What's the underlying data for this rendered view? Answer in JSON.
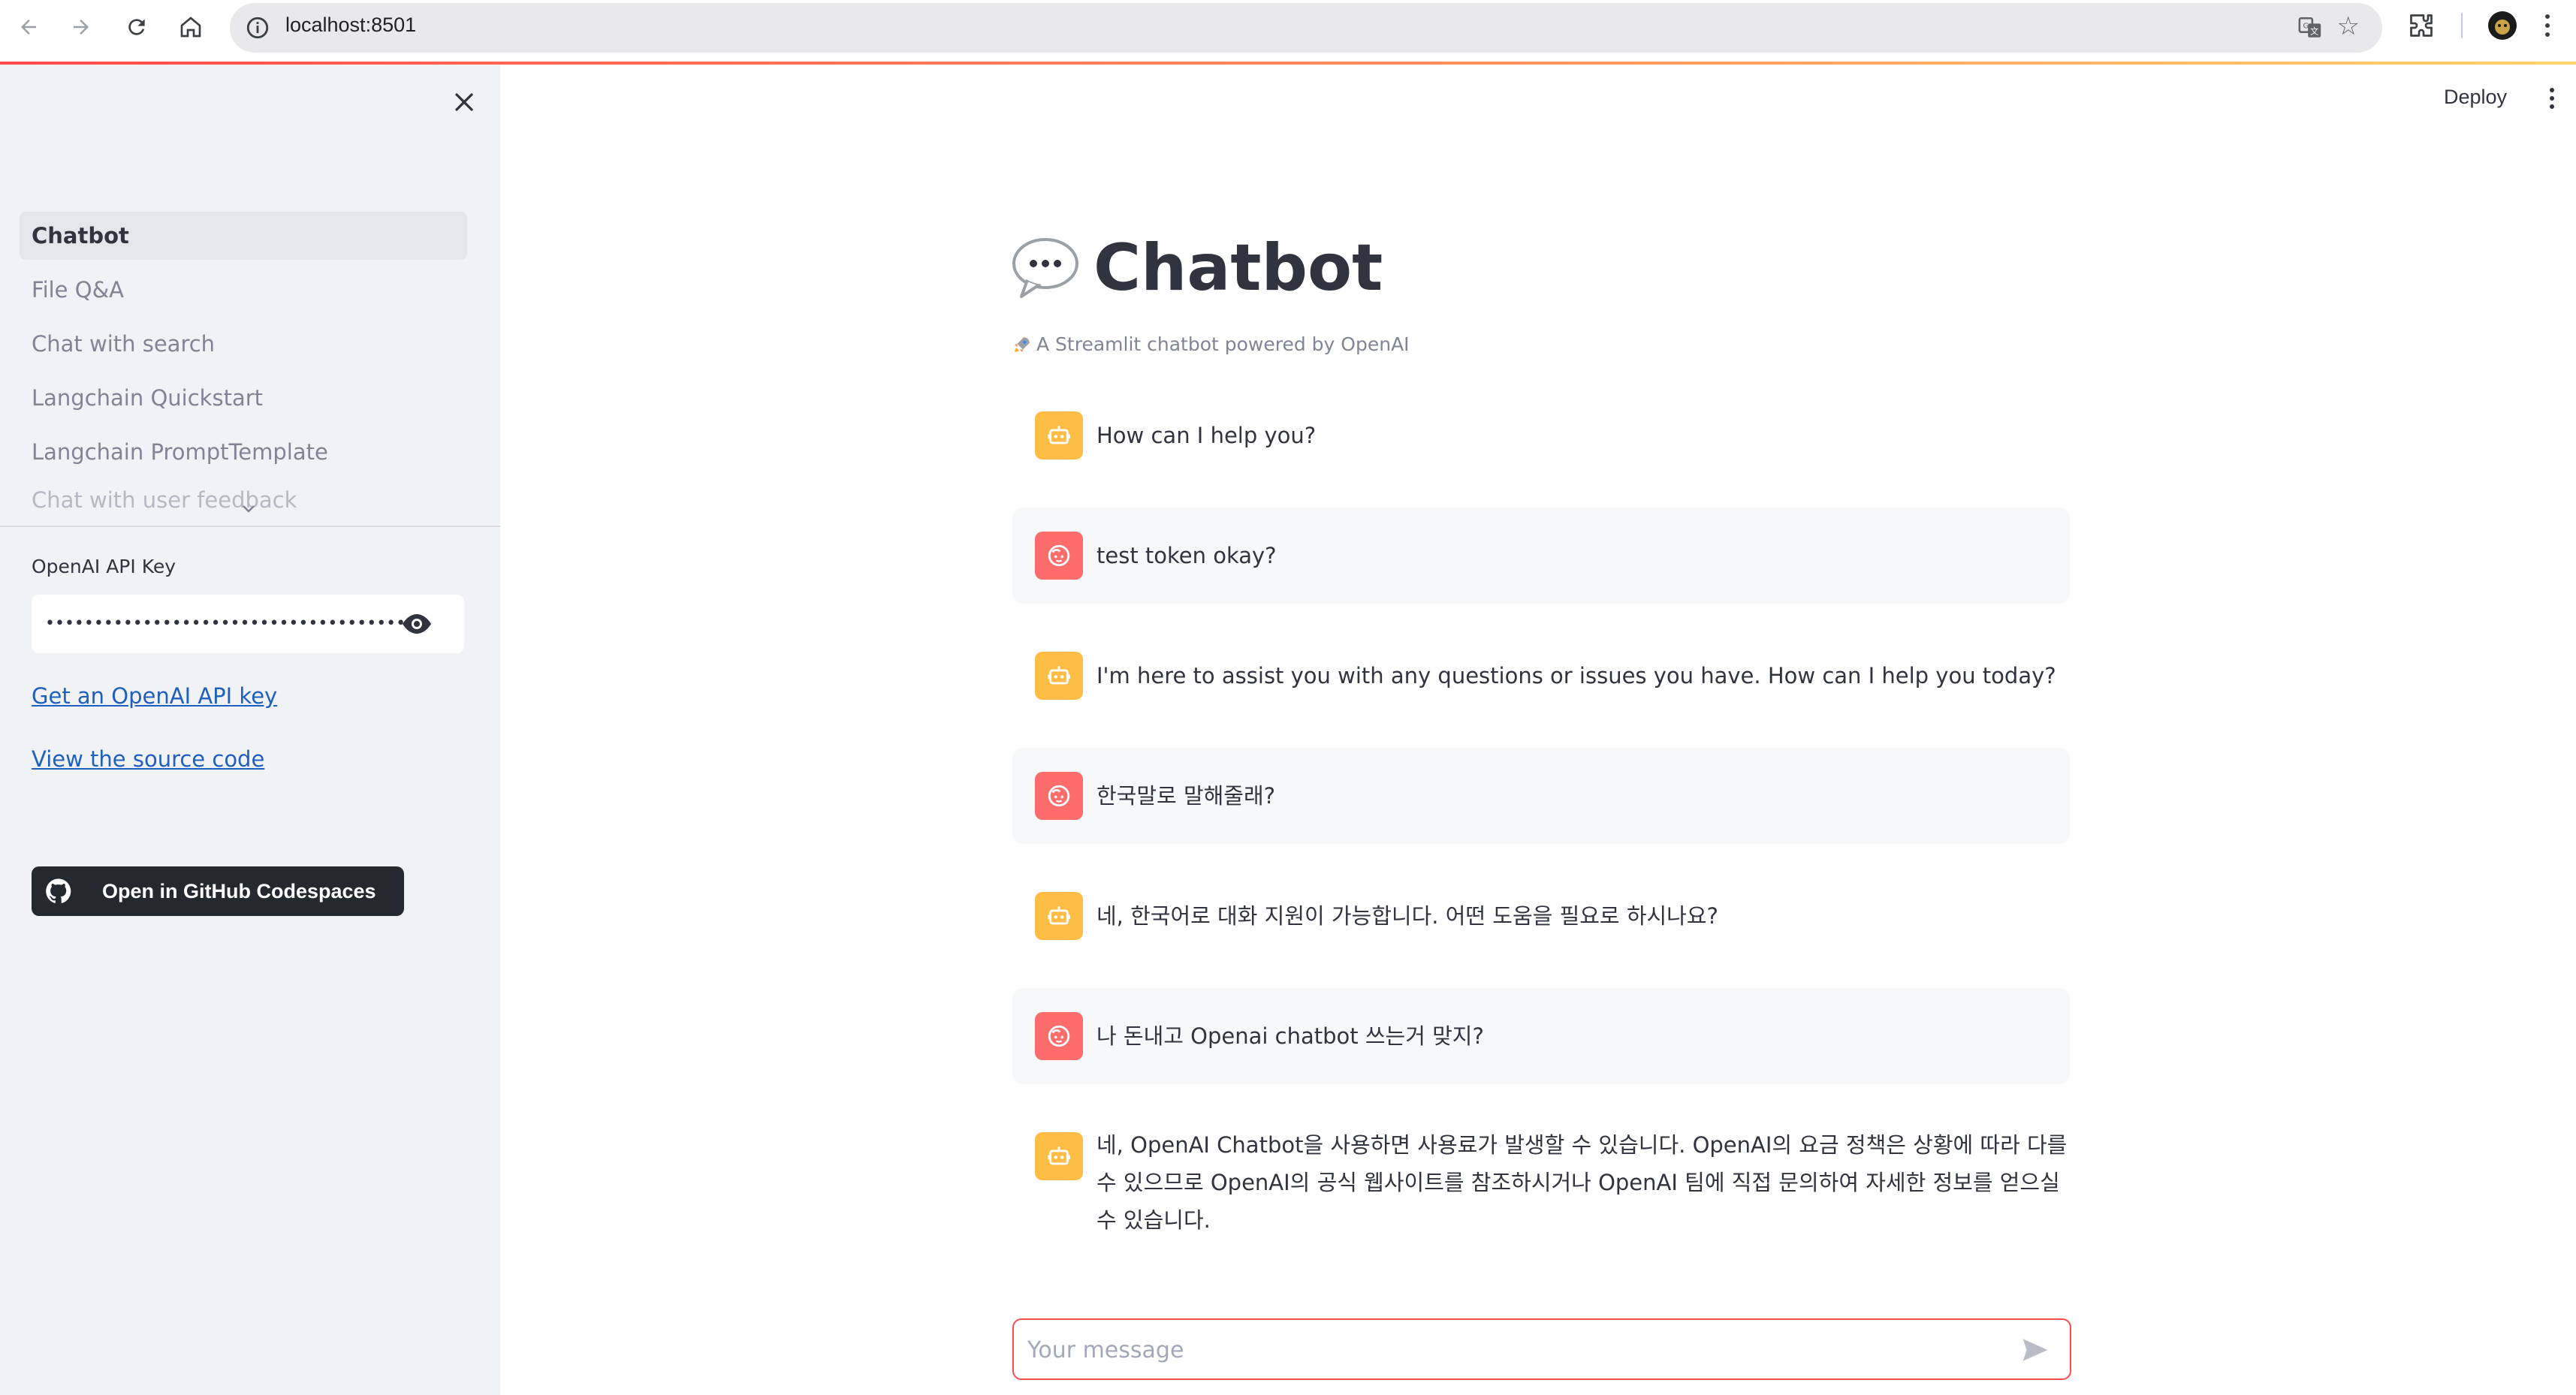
{
  "browser": {
    "url": "localhost:8501"
  },
  "sidebar": {
    "nav_items": [
      {
        "label": "Chatbot",
        "active": true
      },
      {
        "label": "File Q&A"
      },
      {
        "label": "Chat with search"
      },
      {
        "label": "Langchain Quickstart"
      },
      {
        "label": "Langchain PromptTemplate"
      },
      {
        "label": "Chat with user feedback"
      }
    ],
    "api_key_label": "OpenAI API Key",
    "api_key_value": "•••••••••••••••••••••••••••••••••••••••••••••••••",
    "get_key_link": "Get an OpenAI API key",
    "source_link": "View the source code",
    "codespaces_button": "Open in GitHub Codespaces"
  },
  "header": {
    "deploy_label": "Deploy"
  },
  "main": {
    "title": "Chatbot",
    "title_icon": "speech-balloon-icon",
    "caption": "A Streamlit chatbot powered by OpenAI",
    "caption_icon": "rocket-icon",
    "messages": [
      {
        "role": "assistant",
        "text": "How can I help you?"
      },
      {
        "role": "user",
        "text": "test token okay?"
      },
      {
        "role": "assistant",
        "text": "I'm here to assist you with any questions or issues you have. How can I help you today?"
      },
      {
        "role": "user",
        "text": "한국말로 말해줄래?"
      },
      {
        "role": "assistant",
        "text": "네, 한국어로 대화 지원이 가능합니다. 어떤 도움을 필요로 하시나요?"
      },
      {
        "role": "user",
        "text": "나 돈내고 Openai chatbot 쓰는거 맞지?"
      },
      {
        "role": "assistant",
        "text": "네, OpenAI Chatbot을 사용하면 사용료가 발생할 수 있습니다. OpenAI의 요금 정책은 상황에 따라 다를 수 있으므로 OpenAI의 공식 웹사이트를 참조하시거나 OpenAI 팀에 직접 문의하여 자세한 정보를 얻으실 수 있습니다."
      }
    ],
    "input_placeholder": "Your message"
  },
  "colors": {
    "accent": "#ff4b4b",
    "assistant_avatar": "#ffbd45",
    "user_avatar": "#ff6c6c",
    "sidebar_bg": "#f0f2f6"
  }
}
